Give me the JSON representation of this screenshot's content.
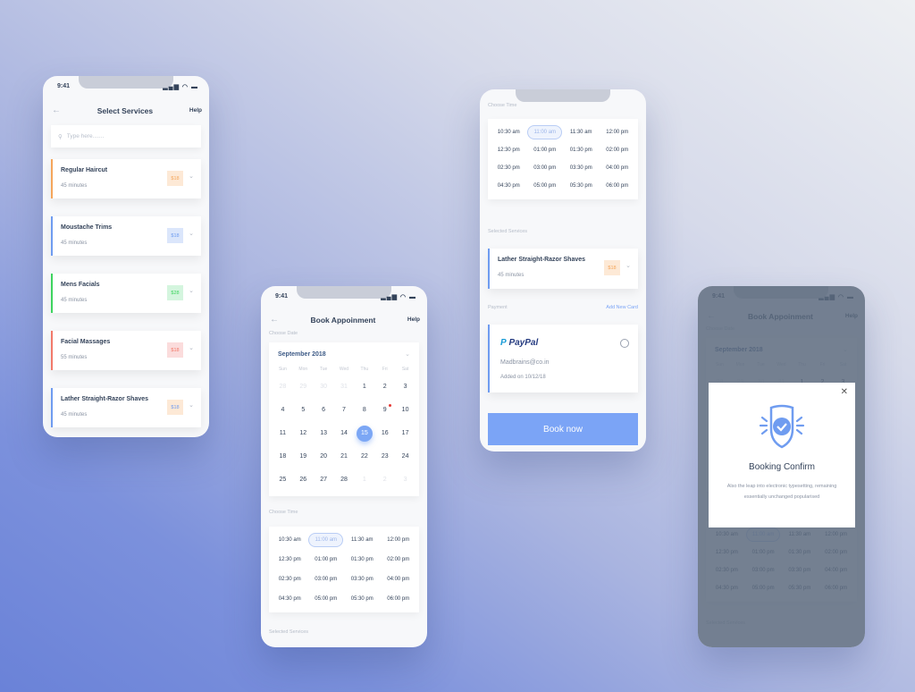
{
  "colors": {
    "accent": "#7ba4f6",
    "orange": "#f5a65b",
    "blue": "#6f9cf0",
    "green": "#3ed45f",
    "red": "#f27a6a"
  },
  "status": {
    "time": "9:41",
    "icons": "signal wifi battery"
  },
  "select_services": {
    "title": "Select Services",
    "help": "Help",
    "search_placeholder": "Type here.......",
    "services": [
      {
        "name": "Regular Haircut",
        "duration": "45 minutes",
        "price": "$18",
        "color": "#f5a65b",
        "badge_bg": "#fde9d6"
      },
      {
        "name": "Moustache Trims",
        "duration": "45 minutes",
        "price": "$18",
        "color": "#6f9cf0",
        "badge_bg": "#dbe6fb"
      },
      {
        "name": "Mens Facials",
        "duration": "45 minutes",
        "price": "$28",
        "color": "#3ed45f",
        "badge_bg": "#d4f5de"
      },
      {
        "name": "Facial Massages",
        "duration": "55 minutes",
        "price": "$18",
        "color": "#f27a6a",
        "badge_bg": "#fbdcdc"
      },
      {
        "name": "Lather Straight-Razor Shaves",
        "duration": "45 minutes",
        "price": "$18",
        "color": "#6f9cf0",
        "badge_bg": "#fde9d6"
      }
    ]
  },
  "book": {
    "title": "Book Appoinment",
    "help": "Help",
    "choose_date": "Choose Date",
    "month": "September 2018",
    "weekdays": [
      "Sun",
      "Mon",
      "Tue",
      "Wed",
      "Thu",
      "Fri",
      "Sat"
    ],
    "weeks": [
      [
        "28",
        "29",
        "30",
        "31",
        "1",
        "2",
        "3"
      ],
      [
        "4",
        "5",
        "6",
        "7",
        "8",
        "9",
        "10"
      ],
      [
        "11",
        "12",
        "13",
        "14",
        "15",
        "16",
        "17"
      ],
      [
        "18",
        "19",
        "20",
        "21",
        "22",
        "23",
        "24"
      ],
      [
        "25",
        "26",
        "27",
        "28",
        "1",
        "2",
        "3"
      ]
    ],
    "selected_day": "15",
    "marked_day": "9",
    "choose_time": "Choose Time",
    "times": [
      "10:30 am",
      "11:00 am",
      "11:30 am",
      "12:00 pm",
      "12:30 pm",
      "01:00 pm",
      "01:30 pm",
      "02:00 pm",
      "02:30 pm",
      "03:00 pm",
      "03:30 pm",
      "04:00 pm",
      "04:30 pm",
      "05:00 pm",
      "05:30 pm",
      "06:00 pm"
    ],
    "selected_time": "11:00 am",
    "selected_services": "Selected Services"
  },
  "payment": {
    "selected_service": {
      "name": "Lather Straight-Razor Shaves",
      "duration": "45 minutes",
      "price": "$18"
    },
    "label": "Payment",
    "add_card": "Add New Card",
    "paypal": {
      "brand": "PayPal",
      "email": "Madbrains@co.in",
      "added": "Added on 10/12/18"
    },
    "book_now": "Book now"
  },
  "confirm": {
    "title": "Booking Confirm",
    "description": "Also the leap into electronic typesetting, remaining essentially unchanged popularised"
  }
}
